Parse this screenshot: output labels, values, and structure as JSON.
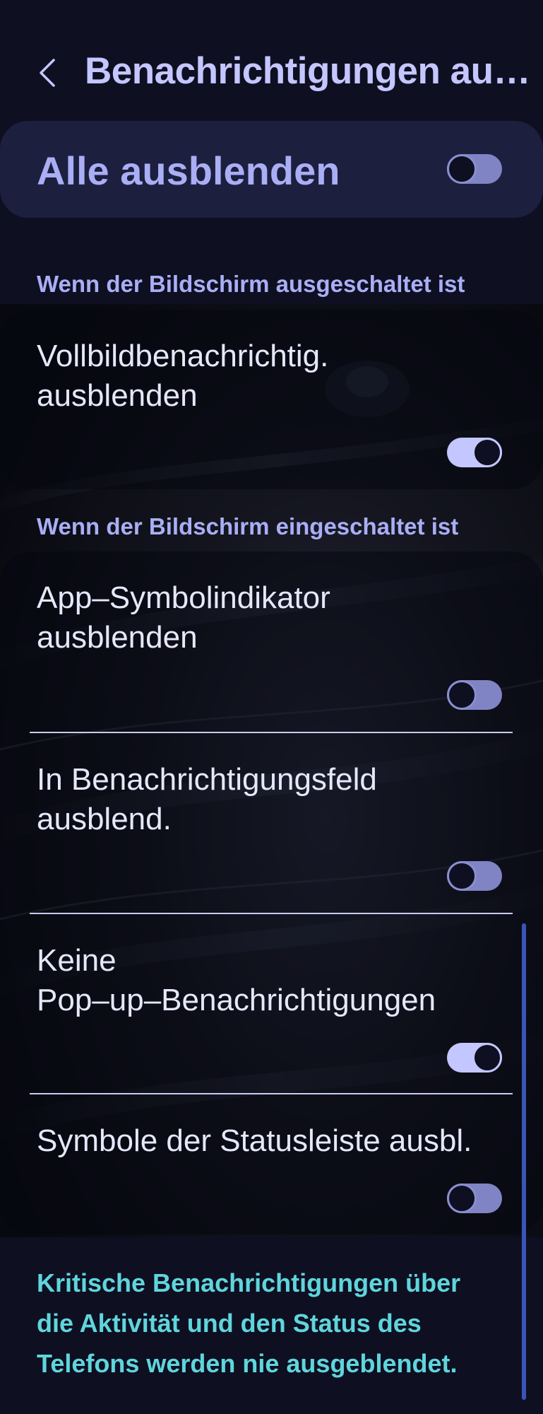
{
  "header": {
    "back_icon": "chevron-left-icon",
    "title": "Benachrichtigungen au…"
  },
  "master": {
    "label": "Alle ausblenden",
    "enabled": false
  },
  "sections": [
    {
      "header": "Wenn der Bildschirm ausgeschaltet ist",
      "items": [
        {
          "lines": [
            "Vollbildbenachrichtig.",
            "ausblenden"
          ],
          "enabled": true
        }
      ]
    },
    {
      "header": "Wenn der Bildschirm eingeschaltet ist",
      "items": [
        {
          "lines": [
            "App–Symbolindikator",
            "ausblenden"
          ],
          "enabled": false
        },
        {
          "lines": [
            "In Benachrichtigungsfeld",
            "ausblend."
          ],
          "enabled": false
        },
        {
          "lines": [
            "Keine",
            "Pop–up–Benachrichtigungen"
          ],
          "enabled": true
        },
        {
          "lines": [
            "Symbole der Statusleiste ausbl."
          ],
          "enabled": false
        }
      ]
    }
  ],
  "footer": {
    "lines": [
      "Kritische Benachrichtigungen über",
      "die Aktivität und den Status des",
      "Telefons werden nie ausgeblendet."
    ]
  },
  "colors": {
    "background": "#0e0f21",
    "accent": "#c4c6ff",
    "master_card": "#1d1f3f",
    "footer_text": "#5fd5dc",
    "scrollbar": "#3a55b8"
  }
}
